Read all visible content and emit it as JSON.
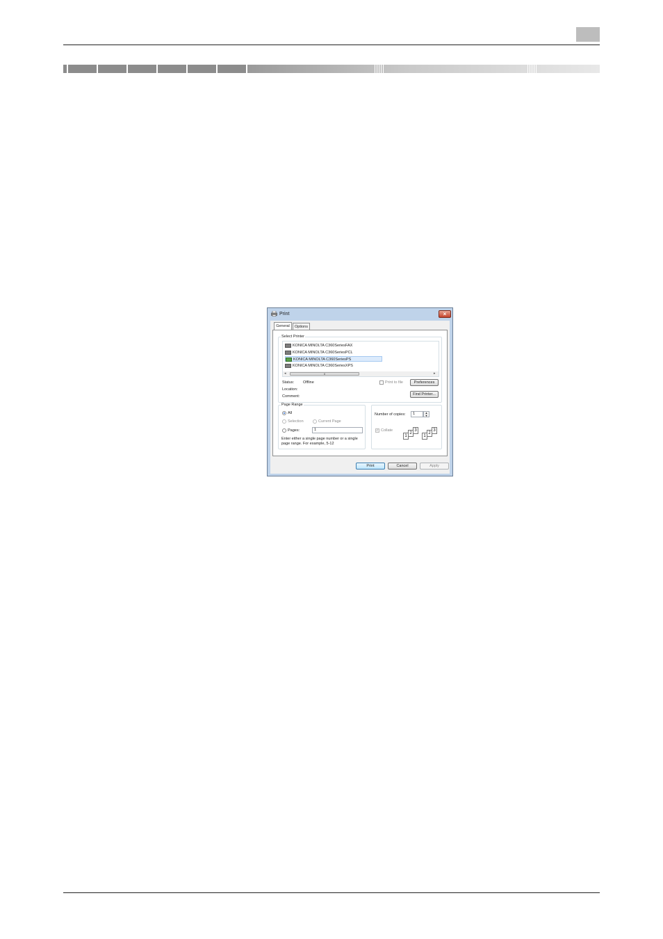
{
  "dialog": {
    "title": "Print",
    "tabs": [
      {
        "label": "General"
      },
      {
        "label": "Options"
      }
    ],
    "select_printer": {
      "group_label": "Select Printer",
      "printers": [
        "KONICA MINOLTA C360SeriesFAX",
        "KONICA MINOLTA C360SeriesPCL",
        "KONICA MINOLTA C360SeriesPS",
        "KONICA MINOLTA C360SeriesXPS"
      ],
      "selected_index": 2,
      "status_label": "Status:",
      "status_value": "Offline",
      "location_label": "Location:",
      "comment_label": "Comment:",
      "print_to_file_label": "Print to file",
      "preferences_label": "Preferences",
      "find_printer_label": "Find Printer..."
    },
    "page_range": {
      "group_label": "Page Range",
      "all_label": "All",
      "selection_label": "Selection",
      "current_page_label": "Current Page",
      "pages_label": "Pages:",
      "pages_value": "1",
      "hint": "Enter either a single page number or a single page range.  For example, 5-12"
    },
    "copies": {
      "number_label": "Number of copies:",
      "number_value": "1",
      "collate_label": "Collate",
      "collate_pages_a": [
        "1",
        "2",
        "3"
      ],
      "collate_pages_b": [
        "1",
        "2",
        "3"
      ]
    },
    "buttons": {
      "print": "Print",
      "cancel": "Cancel",
      "apply": "Apply"
    },
    "colors": {
      "frame": "#bfd3ea",
      "close": "#c4432c",
      "selection": "#dcebfc"
    }
  }
}
